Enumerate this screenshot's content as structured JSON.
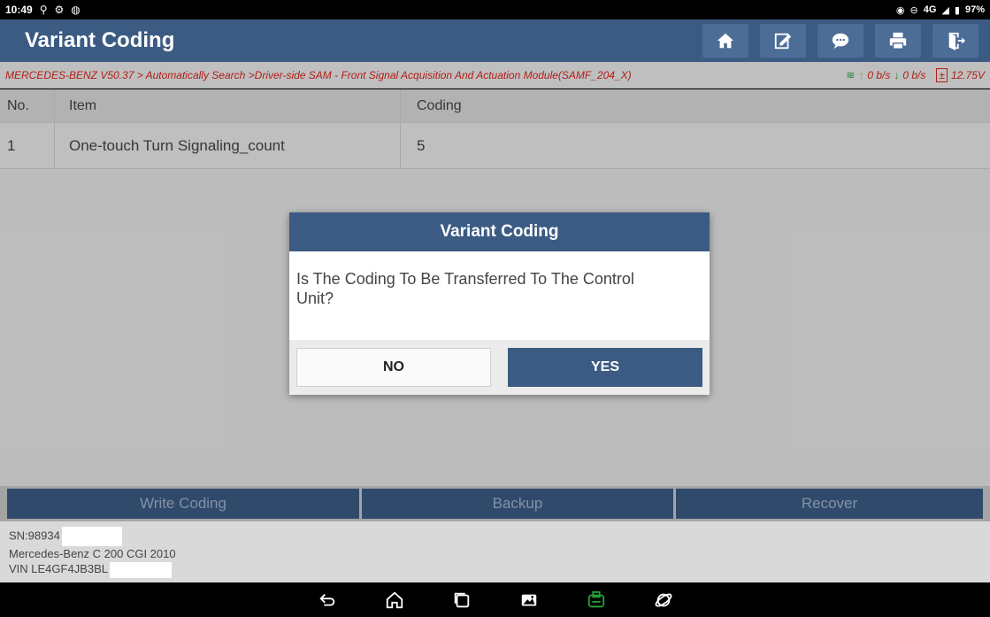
{
  "status": {
    "time": "10:49",
    "battery": "97%",
    "network": "4G"
  },
  "app": {
    "title": "Variant Coding",
    "header_icons": [
      "home-icon",
      "edit-icon",
      "chat-icon",
      "print-icon",
      "exit-icon"
    ]
  },
  "breadcrumb": {
    "path": "MERCEDES-BENZ V50.37 > Automatically Search >Driver-side SAM - Front Signal Acquisition And Actuation Module(SAMF_204_X)",
    "upload": "0 b/s",
    "download": "0 b/s",
    "voltage": "12.75V"
  },
  "table": {
    "headers": {
      "no": "No.",
      "item": "Item",
      "coding": "Coding"
    },
    "rows": [
      {
        "no": "1",
        "item": "One-touch Turn Signaling_count",
        "coding": "5"
      }
    ]
  },
  "dialog": {
    "title": "Variant Coding",
    "message": "Is The Coding To Be Transferred To The Control Unit?",
    "no_label": "NO",
    "yes_label": "YES"
  },
  "actions": {
    "write": "Write Coding",
    "backup": "Backup",
    "recover": "Recover"
  },
  "footer": {
    "sn": "SN:98934",
    "vehicle": "Mercedes-Benz C 200 CGI 2010",
    "vin": "VIN LE4GF4JB3BL"
  },
  "colors": {
    "header_blue": "#3b5b83",
    "breadcrumb_red": "#d9251d",
    "wifi_green": "#23a33a"
  }
}
